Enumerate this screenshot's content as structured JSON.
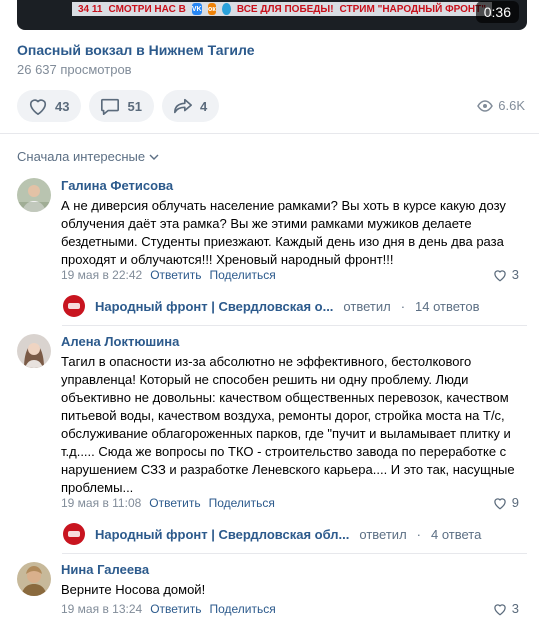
{
  "video": {
    "ticker_left": "34 11",
    "ticker_text1": "СМОТРИ НАС В",
    "ticker_vk": "VK",
    "ticker_text2": "ВСЕ ДЛЯ ПОБЕДЫ!",
    "ticker_text3": "СТРИМ \"НАРОДНЫЙ ФРОНТ\"",
    "duration": "0:36",
    "title": "Опасный вокзал в Нижнем Тагиле",
    "views": "26 637 просмотров"
  },
  "actions": {
    "likes": "43",
    "comments": "51",
    "shares": "4",
    "views_short": "6.6K"
  },
  "sort_label": "Сначала интересные",
  "comments": [
    {
      "author": "Галина Фетисова",
      "text": "А не диверсия облучать население рамками? Вы хоть в курсе какую дозу облучения даёт эта рамка? Вы же этими рамками мужиков делаете бездетными. Студенты приезжают. Каждый день изо дня в день два раза проходят и облучаются!!! Хреновый народный фронт!!!",
      "date": "19 мая в 22:42",
      "reply": "Ответить",
      "share": "Поделиться",
      "likes": "3",
      "thread": {
        "name": "Народный фронт | Свердловская о...",
        "action": "ответил",
        "count": "14 ответов"
      }
    },
    {
      "author": "Алена Локтюшина",
      "text": "Тагил в опасности из-за абсолютно не эффективного, бестолкового управленца! Который не способен решить ни одну проблему. Люди объективно не довольны: качеством общественных перевозок, качеством питьевой воды, качеством воздуха, ремонты дорог, стройка моста на Т/с, обслуживание облагороженных парков, где \"пучит и выламывает плитку и т.д..... Сюда же вопросы по ТКО - строительство завода по переработке с нарушением СЗЗ и разработке Леневского карьера.... И это так, насущные проблемы...",
      "date": "19 мая в 11:08",
      "reply": "Ответить",
      "share": "Поделиться",
      "likes": "9",
      "thread": {
        "name": "Народный фронт | Свердловская обл...",
        "action": "ответил",
        "count": "4 ответа"
      }
    },
    {
      "author": "Нина Галеева",
      "text": "Верните Носова домой!",
      "date": "19 мая в 13:24",
      "reply": "Ответить",
      "share": "Поделиться",
      "likes": "3"
    }
  ],
  "colors": {
    "link": "#2c5a8c",
    "muted": "#818c99",
    "button_bg": "#f0f2f5",
    "brand_red": "#c8141f"
  }
}
